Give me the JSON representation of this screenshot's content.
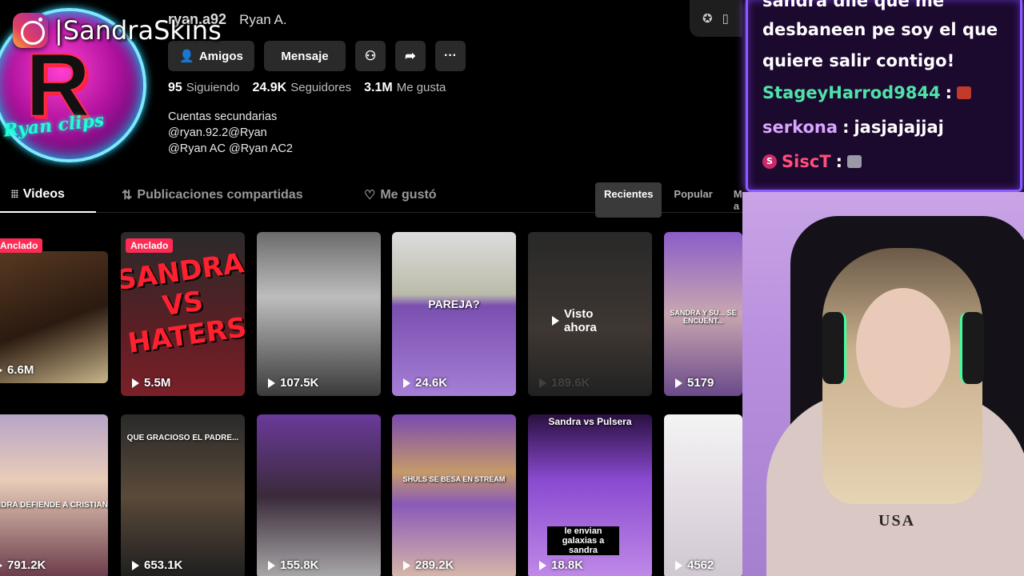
{
  "overlay": {
    "instagram_handle": "|SandraSkins"
  },
  "profile": {
    "avatar_letter": "R",
    "avatar_script": "Ryan clips",
    "username": "ryan.a92",
    "nickname": "Ryan A.",
    "buttons": {
      "friends": "Amigos",
      "message": "Mensaje"
    },
    "stats": [
      {
        "value": "95",
        "label": "Siguiendo"
      },
      {
        "value": "24.9K",
        "label": "Seguidores"
      },
      {
        "value": "3.1M",
        "label": "Me gusta"
      }
    ],
    "bio": [
      "Cuentas secundarias",
      "@ryan.92.2@Ryan",
      "@Ryan AC @Ryan AC2"
    ]
  },
  "tabs": {
    "videos": "Videos",
    "reposts": "Publicaciones compartidas",
    "liked": "Me gustó"
  },
  "sort": {
    "recent": "Recientes",
    "popular": "Popular",
    "more": "Más a"
  },
  "videos": [
    {
      "views": "6.6M",
      "pinned": "Anclado"
    },
    {
      "views": "5.5M",
      "pinned": "Anclado",
      "caption": "SANDRA VS HATERS"
    },
    {
      "views": "107.5K"
    },
    {
      "views": "24.6K",
      "caption": "PAREJA?"
    },
    {
      "views": "189.6K",
      "watched": "Visto ahora"
    },
    {
      "views": "5179",
      "caption": "SANDRA Y SU... SE ENCUENT..."
    },
    {
      "views": "791.2K",
      "caption": "SANDRA DEFIENDE A CRISTIAN"
    },
    {
      "views": "653.1K",
      "caption": "QUE GRACIOSO EL PADRE..."
    },
    {
      "views": "155.8K"
    },
    {
      "views": "289.2K",
      "caption": "SHULS SE BESA EN STREAM"
    },
    {
      "views": "18.8K",
      "caption": "Sandra vs Pulsera",
      "caption2": "le envian galaxias a sandra"
    },
    {
      "views": "4562"
    }
  ],
  "chat": {
    "partial_line": "sandra dile que me",
    "message1": [
      "desbaneen pe soy el que",
      "quiere salir contigo!"
    ],
    "entries": [
      {
        "user": "StageyHarrod9844",
        "sep": ":",
        "text": "",
        "color": "#4fe3a8"
      },
      {
        "user": "serkona",
        "sep": ":",
        "text": "jasjajajjaj",
        "color": "#d9a6ff"
      },
      {
        "user": "SiscT",
        "sep": ":",
        "text": "",
        "color": "#ff4f7a"
      }
    ]
  },
  "webcam": {
    "shirt_text": "USA"
  }
}
